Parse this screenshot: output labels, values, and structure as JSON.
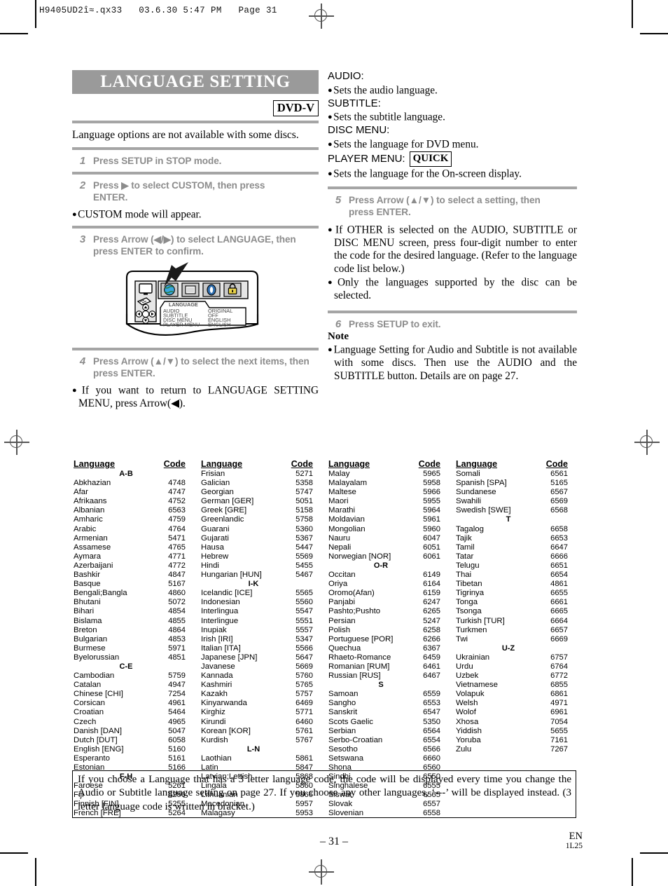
{
  "print_header": "H9405UD2î≈.qx33   03.6.30 5:47 PM   Page 31",
  "left": {
    "title": "LANGUAGE SETTING",
    "disc_badge": "DVD-V",
    "intro": "Language options are not available with some discs.",
    "steps": [
      {
        "num": "1",
        "text": "Press SETUP in STOP mode."
      },
      {
        "num": "2",
        "text": "Press ▶ to select CUSTOM, then press ENTER."
      },
      {
        "num": "3",
        "text": "Press Arrow (◀/▶) to select LANGUAGE, then press ENTER to confirm."
      },
      {
        "num": "4",
        "text": "Press Arrow (▲/▼) to select the next items, then press ENTER."
      }
    ],
    "note_step2": "CUSTOM mode will appear.",
    "note_step4": "If you want to return to LANGUAGE SETTING MENU, press Arrow(◀).",
    "diagram": {
      "tab_label": "LANGUAGE",
      "rows": [
        {
          "item": "AUDIO",
          "value": "ORIGINAL"
        },
        {
          "item": "SUBTITLE",
          "value": "OFF"
        },
        {
          "item": "DISC MENU",
          "value": "ENGLISH"
        },
        {
          "item": "PLAYER MENU",
          "value": "ENGLISH"
        }
      ],
      "icons": [
        "globe-icon",
        "screen-icon",
        "disc-icon",
        "lock-icon"
      ]
    }
  },
  "right": {
    "settings": [
      {
        "label": "AUDIO:",
        "desc": "Sets the audio language."
      },
      {
        "label": "SUBTITLE:",
        "desc": "Sets the subtitle language."
      },
      {
        "label": "DISC MENU:",
        "desc": "Sets the language for DVD menu."
      },
      {
        "label": "PLAYER MENU:",
        "badge": "QUICK",
        "desc": "Sets the language for the On-screen display."
      }
    ],
    "steps": [
      {
        "num": "5",
        "text": "Press Arrow (▲/▼) to select a setting, then press ENTER."
      },
      {
        "num": "6",
        "text": "Press SETUP to exit."
      }
    ],
    "bullets_step5": [
      "If OTHER is selected on the AUDIO, SUBTITLE or DISC MENU screen, press four-digit number to enter the code for the desired language. (Refer to the language code list below.)",
      "Only the languages supported by the disc can be selected."
    ],
    "note_heading": "Note",
    "note_text": "Language Setting for Audio and Subtitle is not available with some discs. Then use the AUDIO and the SUBTITLE button. Details are on page 27."
  },
  "code_table": {
    "header_language": "Language",
    "header_code": "Code",
    "columns": [
      {
        "entries": [
          {
            "group": "A-B"
          },
          {
            "name": "Abkhazian",
            "code": "4748"
          },
          {
            "name": "Afar",
            "code": "4747"
          },
          {
            "name": "Afrikaans",
            "code": "4752"
          },
          {
            "name": "Albanian",
            "code": "6563"
          },
          {
            "name": "Amharic",
            "code": "4759"
          },
          {
            "name": "Arabic",
            "code": "4764"
          },
          {
            "name": "Armenian",
            "code": "5471"
          },
          {
            "name": "Assamese",
            "code": "4765"
          },
          {
            "name": "Aymara",
            "code": "4771"
          },
          {
            "name": "Azerbaijani",
            "code": "4772"
          },
          {
            "name": "Bashkir",
            "code": "4847"
          },
          {
            "name": "Basque",
            "code": "5167"
          },
          {
            "name": "Bengali;Bangla",
            "code": "4860"
          },
          {
            "name": "Bhutani",
            "code": "5072"
          },
          {
            "name": "Bihari",
            "code": "4854"
          },
          {
            "name": "Bislama",
            "code": "4855"
          },
          {
            "name": "Breton",
            "code": "4864"
          },
          {
            "name": "Bulgarian",
            "code": "4853"
          },
          {
            "name": "Burmese",
            "code": "5971"
          },
          {
            "name": "Byelorussian",
            "code": "4851"
          },
          {
            "group": "C-E"
          },
          {
            "name": "Cambodian",
            "code": "5759"
          },
          {
            "name": "Catalan",
            "code": "4947"
          },
          {
            "name": "Chinese [CHI]",
            "code": "7254"
          },
          {
            "name": "Corsican",
            "code": "4961"
          },
          {
            "name": "Croatian",
            "code": "5464"
          },
          {
            "name": "Czech",
            "code": "4965"
          },
          {
            "name": "Danish [DAN]",
            "code": "5047"
          },
          {
            "name": "Dutch [DUT]",
            "code": "6058"
          },
          {
            "name": "English [ENG]",
            "code": "5160"
          },
          {
            "name": "Esperanto",
            "code": "5161"
          },
          {
            "name": "Estonian",
            "code": "5166"
          },
          {
            "group": "F-H"
          },
          {
            "name": "Faroese",
            "code": "5261"
          },
          {
            "name": "Fiji",
            "code": "5256"
          },
          {
            "name": "Finnish [FIN]",
            "code": "5255"
          },
          {
            "name": "French [FRE]",
            "code": "5264"
          }
        ]
      },
      {
        "entries": [
          {
            "name": "Frisian",
            "code": "5271"
          },
          {
            "name": "Galician",
            "code": "5358"
          },
          {
            "name": "Georgian",
            "code": "5747"
          },
          {
            "name": "German [GER]",
            "code": "5051"
          },
          {
            "name": "Greek [GRE]",
            "code": "5158"
          },
          {
            "name": "Greenlandic",
            "code": "5758"
          },
          {
            "name": "Guarani",
            "code": "5360"
          },
          {
            "name": "Gujarati",
            "code": "5367"
          },
          {
            "name": "Hausa",
            "code": "5447"
          },
          {
            "name": "Hebrew",
            "code": "5569"
          },
          {
            "name": "Hindi",
            "code": "5455"
          },
          {
            "name": "Hungarian [HUN]",
            "code": "5467"
          },
          {
            "group": "I-K"
          },
          {
            "name": "Icelandic [ICE]",
            "code": "5565"
          },
          {
            "name": "Indonesian",
            "code": "5560"
          },
          {
            "name": "Interlingua",
            "code": "5547"
          },
          {
            "name": "Interlingue",
            "code": "5551"
          },
          {
            "name": "Inupiak",
            "code": "5557"
          },
          {
            "name": "Irish [IRI]",
            "code": "5347"
          },
          {
            "name": "Italian [ITA]",
            "code": "5566"
          },
          {
            "name": "Japanese [JPN]",
            "code": "5647"
          },
          {
            "name": "Javanese",
            "code": "5669"
          },
          {
            "name": "Kannada",
            "code": "5760"
          },
          {
            "name": "Kashmiri",
            "code": "5765"
          },
          {
            "name": "Kazakh",
            "code": "5757"
          },
          {
            "name": "Kinyarwanda",
            "code": "6469"
          },
          {
            "name": "Kirghiz",
            "code": "5771"
          },
          {
            "name": "Kirundi",
            "code": "6460"
          },
          {
            "name": "Korean [KOR]",
            "code": "5761"
          },
          {
            "name": "Kurdish",
            "code": "5767"
          },
          {
            "group": "L-N"
          },
          {
            "name": "Laothian",
            "code": "5861"
          },
          {
            "name": "Latin",
            "code": "5847"
          },
          {
            "name": "Latvian;Lettish",
            "code": "5868"
          },
          {
            "name": "Lingala",
            "code": "5860"
          },
          {
            "name": "Lithuanian",
            "code": "5866"
          },
          {
            "name": "Macedonian",
            "code": "5957"
          },
          {
            "name": "Malagasy",
            "code": "5953"
          }
        ]
      },
      {
        "entries": [
          {
            "name": "Malay",
            "code": "5965"
          },
          {
            "name": "Malayalam",
            "code": "5958"
          },
          {
            "name": "Maltese",
            "code": "5966"
          },
          {
            "name": "Maori",
            "code": "5955"
          },
          {
            "name": "Marathi",
            "code": "5964"
          },
          {
            "name": "Moldavian",
            "code": "5961"
          },
          {
            "name": "Mongolian",
            "code": "5960"
          },
          {
            "name": "Nauru",
            "code": "6047"
          },
          {
            "name": "Nepali",
            "code": "6051"
          },
          {
            "name": "Norwegian [NOR]",
            "code": "6061"
          },
          {
            "group": "O-R"
          },
          {
            "name": "Occitan",
            "code": "6149"
          },
          {
            "name": "Oriya",
            "code": "6164"
          },
          {
            "name": "Oromo(Afan)",
            "code": "6159"
          },
          {
            "name": "Panjabi",
            "code": "6247"
          },
          {
            "name": "Pashto;Pushto",
            "code": "6265"
          },
          {
            "name": "Persian",
            "code": "5247"
          },
          {
            "name": "Polish",
            "code": "6258"
          },
          {
            "name": "Portuguese [POR]",
            "code": "6266"
          },
          {
            "name": "Quechua",
            "code": "6367"
          },
          {
            "name": "Rhaeto-Romance",
            "code": "6459"
          },
          {
            "name": "Romanian [RUM]",
            "code": "6461"
          },
          {
            "name": "Russian [RUS]",
            "code": "6467"
          },
          {
            "group": "S"
          },
          {
            "name": "Samoan",
            "code": "6559"
          },
          {
            "name": "Sangho",
            "code": "6553"
          },
          {
            "name": "Sanskrit",
            "code": "6547"
          },
          {
            "name": "Scots Gaelic",
            "code": "5350"
          },
          {
            "name": "Serbian",
            "code": "6564"
          },
          {
            "name": "Serbo-Croatian",
            "code": "6554"
          },
          {
            "name": "Sesotho",
            "code": "6566"
          },
          {
            "name": "Setswana",
            "code": "6660"
          },
          {
            "name": "Shona",
            "code": "6560"
          },
          {
            "name": "Sindhi",
            "code": "6550"
          },
          {
            "name": "Singhalese",
            "code": "6555"
          },
          {
            "name": "Siswat",
            "code": "6565"
          },
          {
            "name": "Slovak",
            "code": "6557"
          },
          {
            "name": "Slovenian",
            "code": "6558"
          }
        ]
      },
      {
        "entries": [
          {
            "name": "Somali",
            "code": "6561"
          },
          {
            "name": "Spanish [SPA]",
            "code": "5165"
          },
          {
            "name": "Sundanese",
            "code": "6567"
          },
          {
            "name": "Swahili",
            "code": "6569"
          },
          {
            "name": "Swedish [SWE]",
            "code": "6568"
          },
          {
            "group": "T"
          },
          {
            "name": "Tagalog",
            "code": "6658"
          },
          {
            "name": "Tajik",
            "code": "6653"
          },
          {
            "name": "Tamil",
            "code": "6647"
          },
          {
            "name": "Tatar",
            "code": "6666"
          },
          {
            "name": "Telugu",
            "code": "6651"
          },
          {
            "name": "Thai",
            "code": "6654"
          },
          {
            "name": "Tibetan",
            "code": "4861"
          },
          {
            "name": "Tigrinya",
            "code": "6655"
          },
          {
            "name": "Tonga",
            "code": "6661"
          },
          {
            "name": "Tsonga",
            "code": "6665"
          },
          {
            "name": "Turkish [TUR]",
            "code": "6664"
          },
          {
            "name": "Turkmen",
            "code": "6657"
          },
          {
            "name": "Twi",
            "code": "6669"
          },
          {
            "group": "U-Z"
          },
          {
            "name": "Ukrainian",
            "code": "6757"
          },
          {
            "name": "Urdu",
            "code": "6764"
          },
          {
            "name": "Uzbek",
            "code": "6772"
          },
          {
            "name": "Vietnamese",
            "code": "6855"
          },
          {
            "name": "Volapuk",
            "code": "6861"
          },
          {
            "name": "Welsh",
            "code": "4971"
          },
          {
            "name": "Wolof",
            "code": "6961"
          },
          {
            "name": "Xhosa",
            "code": "7054"
          },
          {
            "name": "Yiddish",
            "code": "5655"
          },
          {
            "name": "Yoruba",
            "code": "7161"
          },
          {
            "name": "Zulu",
            "code": "7267"
          }
        ]
      }
    ]
  },
  "bottom_note": "If you choose a Language that has a 3 letter language code, the code will be displayed every time you change the Audio or Subtitle language setting on page 27. If you choose any other languages, ‘---’ will be displayed instead. (3 letter language code is written in bracket.)",
  "footer": {
    "page": "– 31 –",
    "region": "EN",
    "doc_code": "1L25"
  }
}
